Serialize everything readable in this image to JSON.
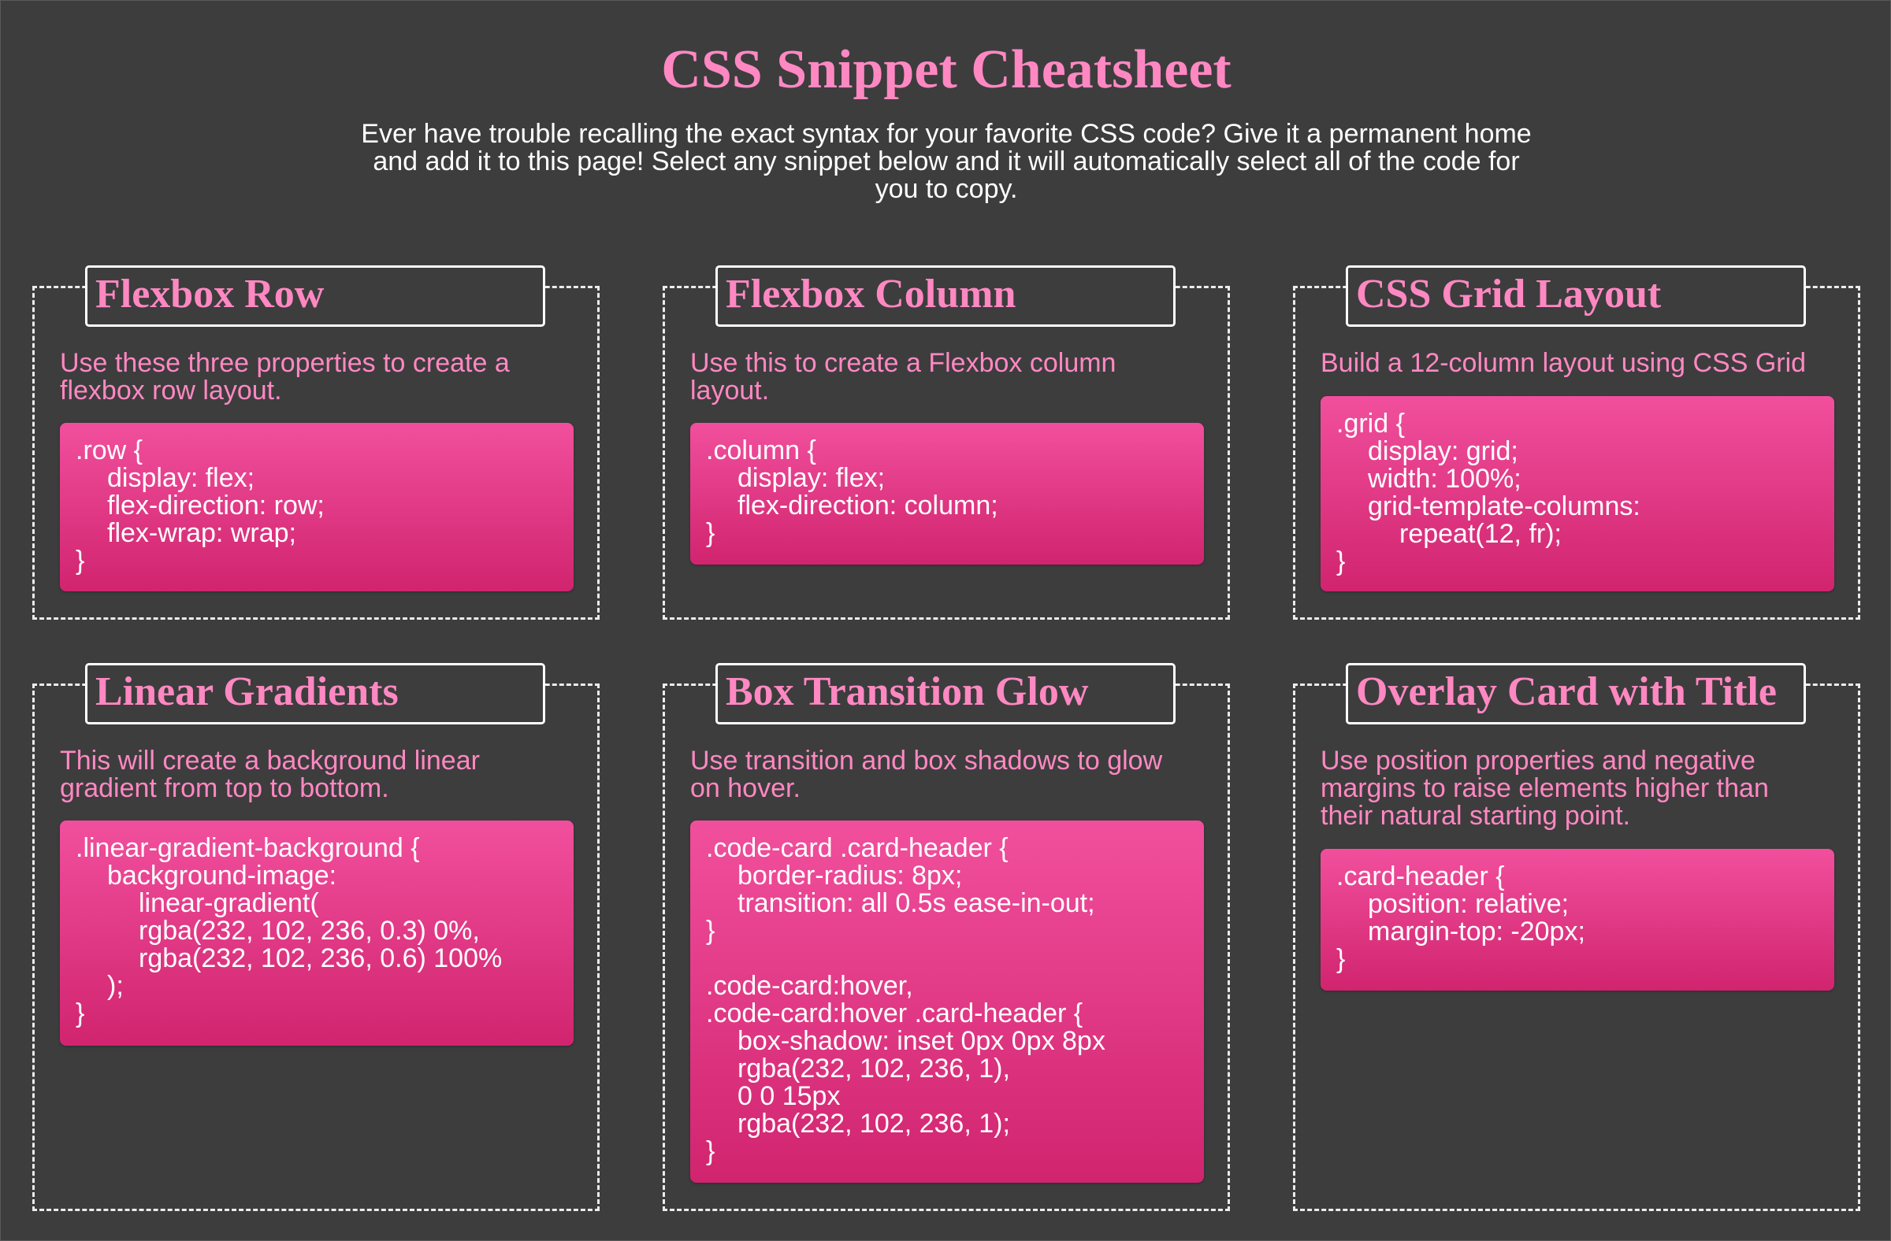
{
  "page": {
    "title": "CSS Snippet Cheatsheet",
    "intro": "Ever have trouble recalling the exact syntax for your favorite CSS code? Give it a permanent home and add it to this page! Select any snippet below and it will automatically select all of the code for you to copy."
  },
  "colors": {
    "background": "#3d3d3d",
    "accent_pink": "#ff88c2",
    "code_gradient_top": "#f14f9d",
    "code_gradient_bottom": "#d1246f",
    "border": "#ececec"
  },
  "cards": [
    {
      "title": "Flexbox Row",
      "description": "Use these three properties to create a flexbox row layout.",
      "code": [
        ".row {",
        "display: flex;",
        "flex-direction: row;",
        "flex-wrap: wrap;",
        "}"
      ]
    },
    {
      "title": "Flexbox Column",
      "description": "Use this to create a Flexbox column layout.",
      "code": [
        ".column {",
        "display: flex;",
        "flex-direction: column;",
        "}"
      ]
    },
    {
      "title": "CSS Grid Layout",
      "description": "Build a 12-column layout using CSS Grid",
      "code": [
        ".grid {",
        "display: grid;",
        "width: 100%;",
        "grid-template-columns:",
        "repeat(12, fr);",
        "}"
      ]
    },
    {
      "title": "Linear Gradients",
      "description": "This will create a background linear gradient from top to bottom.",
      "code": [
        ".linear-gradient-background {",
        "background-image:",
        "linear-gradient(",
        "rgba(232, 102, 236, 0.3) 0%,",
        "rgba(232, 102, 236, 0.6) 100%",
        ");",
        "}"
      ]
    },
    {
      "title": "Box Transition Glow",
      "description": "Use transition and box shadows to glow on hover.",
      "code": [
        ".code-card .card-header {",
        "border-radius: 8px;",
        "transition: all 0.5s ease-in-out;",
        "}",
        "",
        ".code-card:hover,",
        ".code-card:hover .card-header {",
        "box-shadow: inset 0px 0px 8px",
        "rgba(232, 102, 236, 1),",
        "0 0 15px",
        "rgba(232, 102, 236, 1);",
        "}"
      ]
    },
    {
      "title": "Overlay Card with Title",
      "description": "Use position properties and negative margins to raise elements higher than their natural starting point.",
      "code": [
        ".card-header {",
        "position: relative;",
        "margin-top: -20px;",
        "}"
      ]
    }
  ]
}
